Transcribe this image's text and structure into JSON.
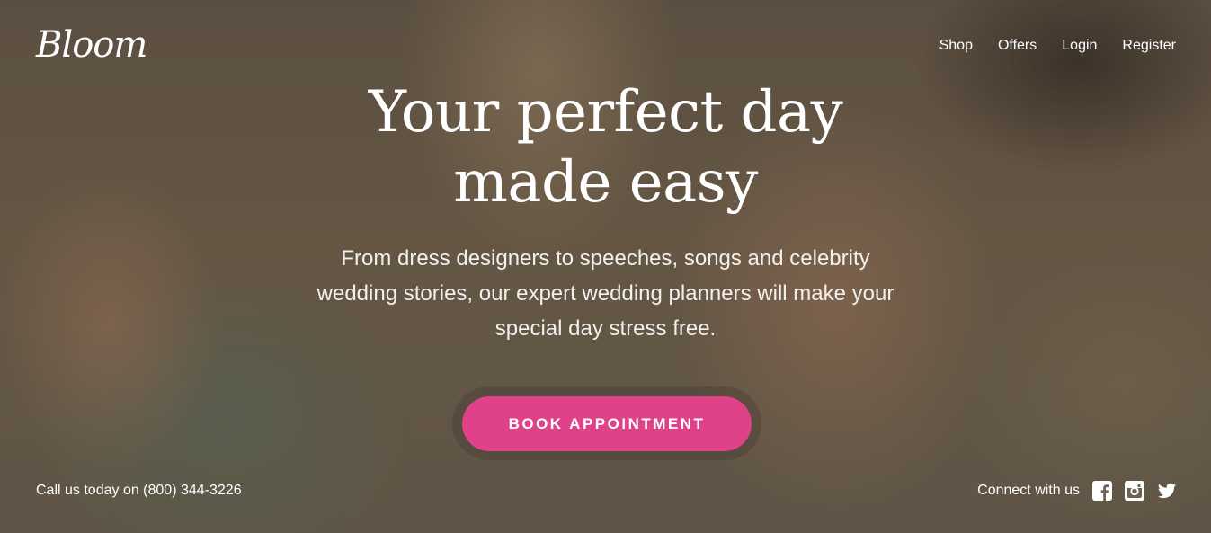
{
  "brand": {
    "logo": "Bloom"
  },
  "nav": {
    "items": [
      {
        "label": "Shop"
      },
      {
        "label": "Offers"
      },
      {
        "label": "Login"
      },
      {
        "label": "Register"
      }
    ]
  },
  "hero": {
    "title_line1": "Your perfect day",
    "title_line2": "made easy",
    "subtitle": "From dress designers to speeches, songs and celebrity wedding stories, our expert wedding planners will make your special day stress free.",
    "cta_label": "BOOK APPOINTMENT"
  },
  "footer": {
    "call_text": "Call us today on (800) 344-3226",
    "connect_label": "Connect with us",
    "social_icons": [
      "facebook-icon",
      "instagram-icon",
      "twitter-icon"
    ]
  },
  "colors": {
    "accent": "#e0428a",
    "text": "#ffffff"
  }
}
